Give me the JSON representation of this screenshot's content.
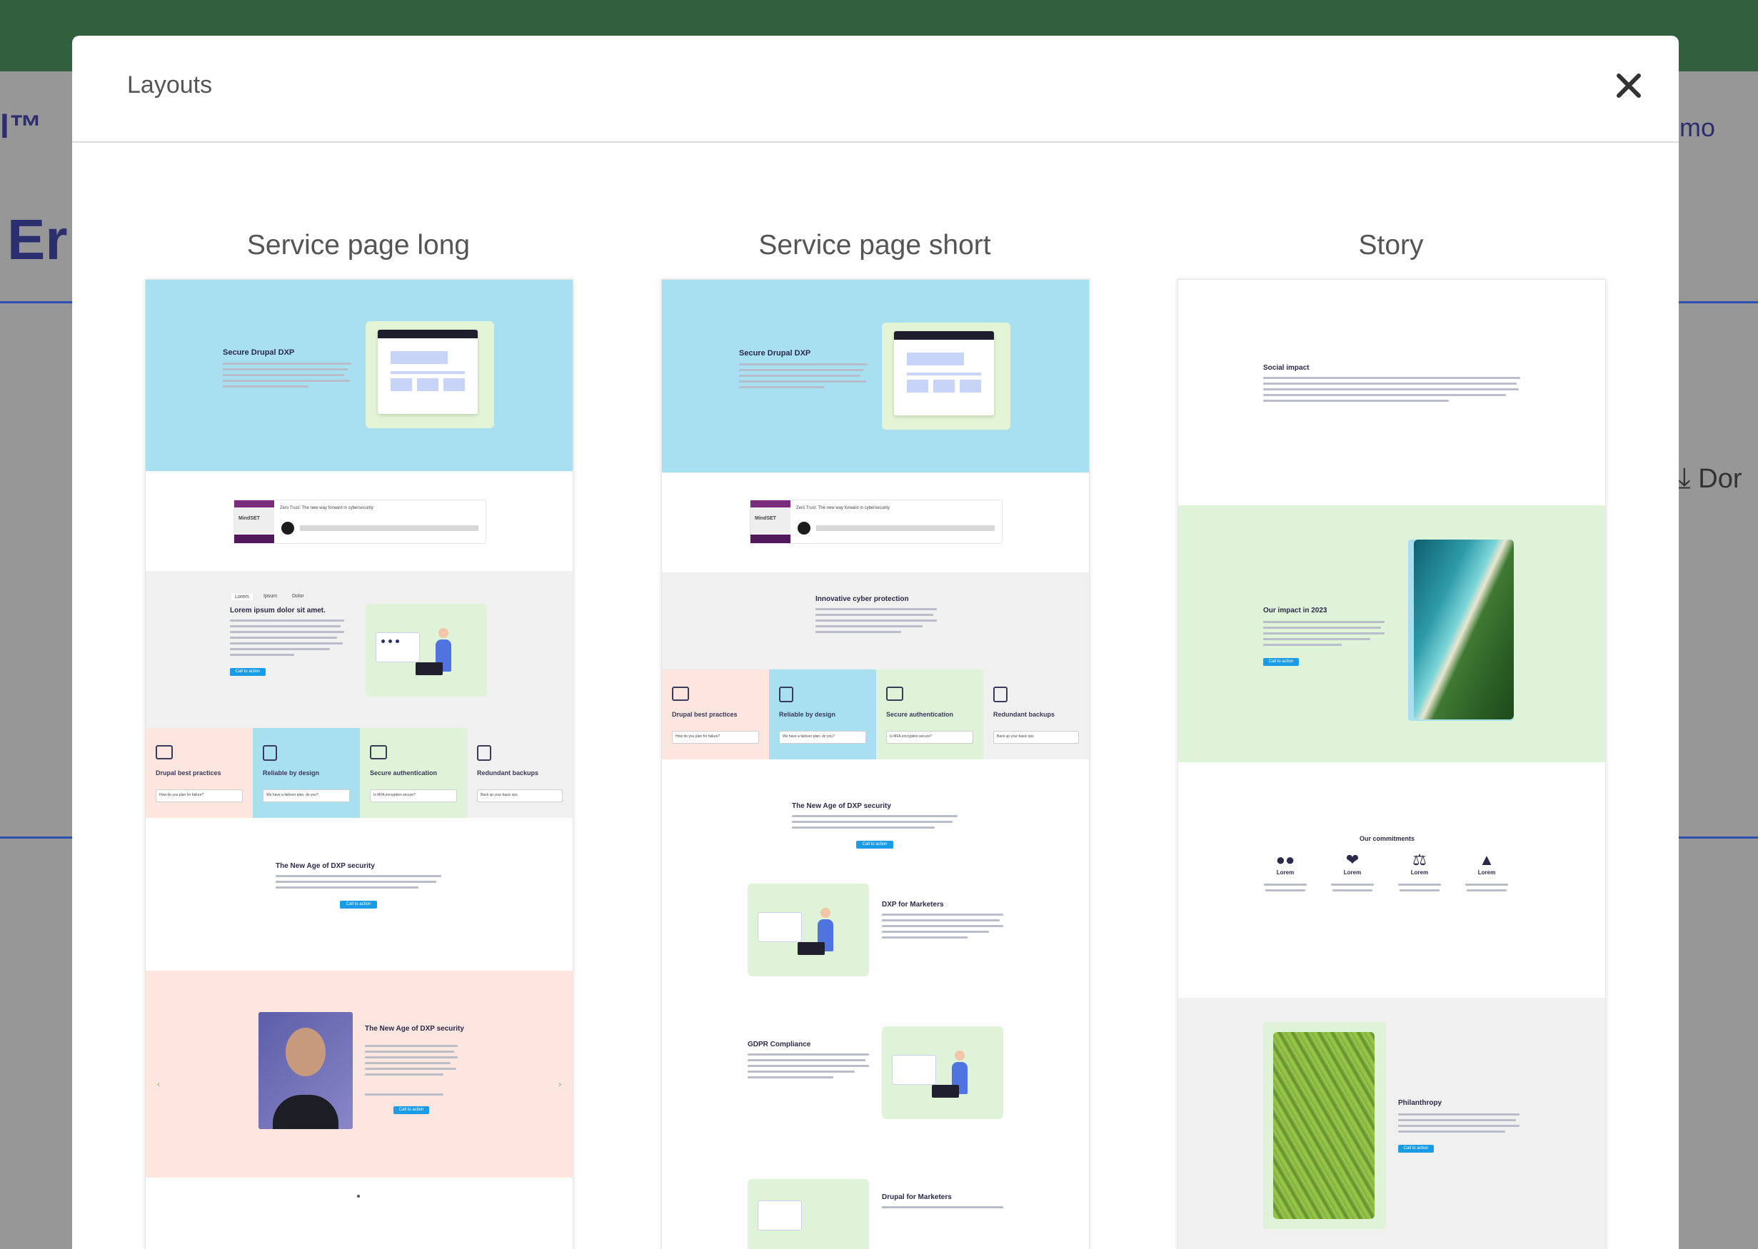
{
  "background": {
    "text_mark": "l™",
    "text_heading": "Er",
    "text_right": "mo",
    "text_download": "Dor"
  },
  "modal": {
    "title": "Layouts",
    "close_label": "✕"
  },
  "layouts": [
    {
      "name": "Service page long",
      "hero_title": "Secure Drupal DXP",
      "podcast_brand": "MindSET",
      "podcast_title": "Zero Trust: The new way forward in cybersecurity",
      "tabs": [
        "Lorem",
        "Ipsum",
        "Dolor"
      ],
      "section_title": "Lorem ipsum dolor sit amet.",
      "cta": "Call to action",
      "features": [
        "Drupal best practices",
        "Reliable by design",
        "Secure authentication",
        "Redundant backups"
      ],
      "feature_selects": [
        "How do you plan for failure?",
        "We have a failover plan, do you?",
        "Is MFA encryption secure?",
        "Back up your basic ops"
      ],
      "dxp_title": "The New Age of DXP security",
      "quote_title": "The New Age of DXP security"
    },
    {
      "name": "Service page short",
      "hero_title": "Secure Drupal DXP",
      "podcast_brand": "MindSET",
      "podcast_title": "Zero Trust: The new way forward in cybersecurity",
      "section_title": "Innovative cyber protection",
      "features": [
        "Drupal best practices",
        "Reliable by design",
        "Secure authentication",
        "Redundant backups"
      ],
      "feature_selects": [
        "How do you plan for failure?",
        "We have a failover plan, do you?",
        "Is MFA encryption secure?",
        "Back up your basic ops"
      ],
      "dxp_title": "The New Age of DXP security",
      "cta": "Call to action",
      "row1_title": "DXP for Marketers",
      "row2_title": "GDPR Compliance",
      "row3_title": "Drupal for Marketers"
    },
    {
      "name": "Story",
      "intro_title": "Social impact",
      "impact_title": "Our impact in 2023",
      "cta": "Call to action",
      "commitments_title": "Our commitments",
      "commitments": [
        "Lorem",
        "Lorem",
        "Lorem",
        "Lorem"
      ],
      "philanthropy_title": "Philanthropy"
    }
  ],
  "colors": {
    "light_blue": "#a9e0f1",
    "light_green": "#dff3d9",
    "light_pink": "#fde6e0",
    "light_gray": "#f0f0f0",
    "cta_blue": "#1a9be6",
    "header_green": "#325f3e"
  }
}
